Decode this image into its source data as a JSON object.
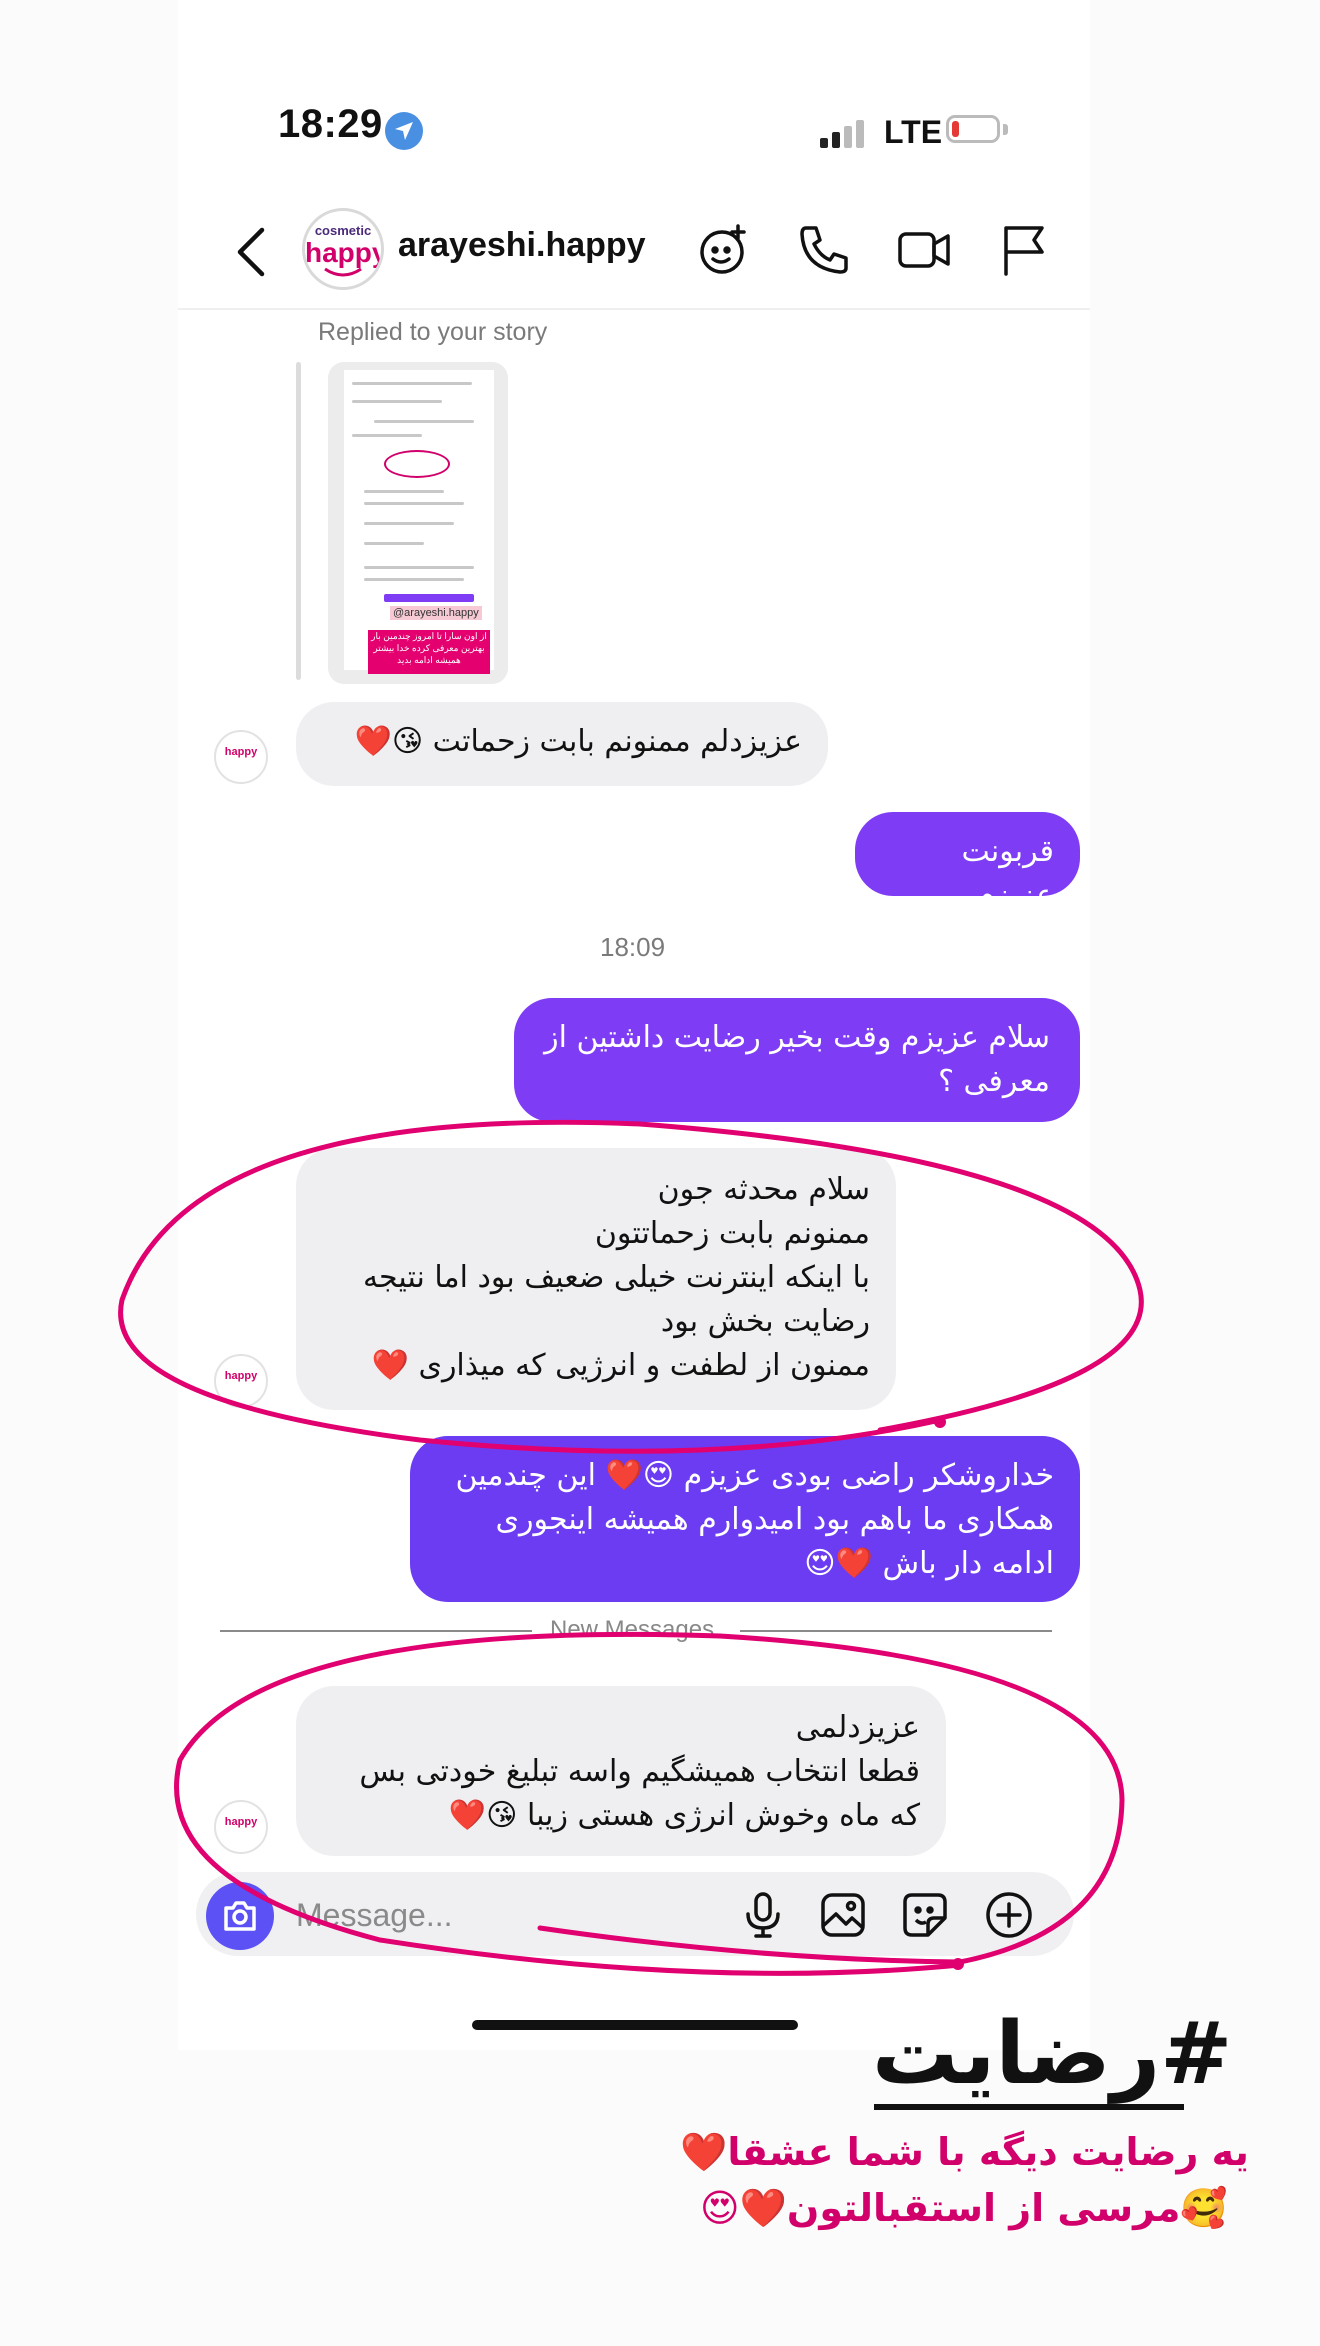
{
  "status_bar": {
    "time": "18:29",
    "network": "LTE"
  },
  "header": {
    "username": "arayeshi.happy",
    "logo_top": "cosmetic",
    "logo_main": "happy"
  },
  "story_reply": {
    "label": "Replied to your story",
    "preview_tag": "@arayeshi.happy",
    "preview_text": "از اون سارا تا امروز چندمین بار بهترین معرفی کرده خدا بیشتر همیشه ادامه بدید"
  },
  "messages": {
    "m1": "عزیزدلم ممنونم بابت زحماتت 😘❤️",
    "m2": "قربونت عزیزم",
    "timestamp": "18:09",
    "m3": "سلام عزیزم وقت بخیر رضایت داشتین از معرفی ؟",
    "m4_lines": [
      "سلام محدثه جون",
      "ممنونم بابت زحماتتون",
      "با اینکه اینترنت خیلی ضعیف بود اما نتیجه",
      "رضایت بخش بود",
      "ممنون از لطفت و انرژیی که میذاری ❤️"
    ],
    "m5_lines": [
      "خداروشکر راضی بودی عزیزم 😍❤️ این چندمین",
      "همکاری ما باهم بود امیدوارم همیشه اینجوری",
      "ادامه دار باش ❤️😍"
    ],
    "new_messages_label": "New Messages",
    "m6_lines": [
      "عزیزدلمی",
      "قطعا انتخاب همیشگیم واسه تبلیغ خودتی بس",
      "که ماه وخوش انرژی هستی زیبا 😘❤️"
    ]
  },
  "composer": {
    "placeholder": "Message..."
  },
  "caption": {
    "hashtag": "#رضایت",
    "line1": "یه رضایت دیگه با شما عشقا❤️",
    "line2": "🥰مرسی از استقبالتون❤️😍"
  },
  "colors": {
    "outgoing": "#7f3cf5",
    "incoming": "#efeff1",
    "accent_pink": "#d1006a"
  }
}
